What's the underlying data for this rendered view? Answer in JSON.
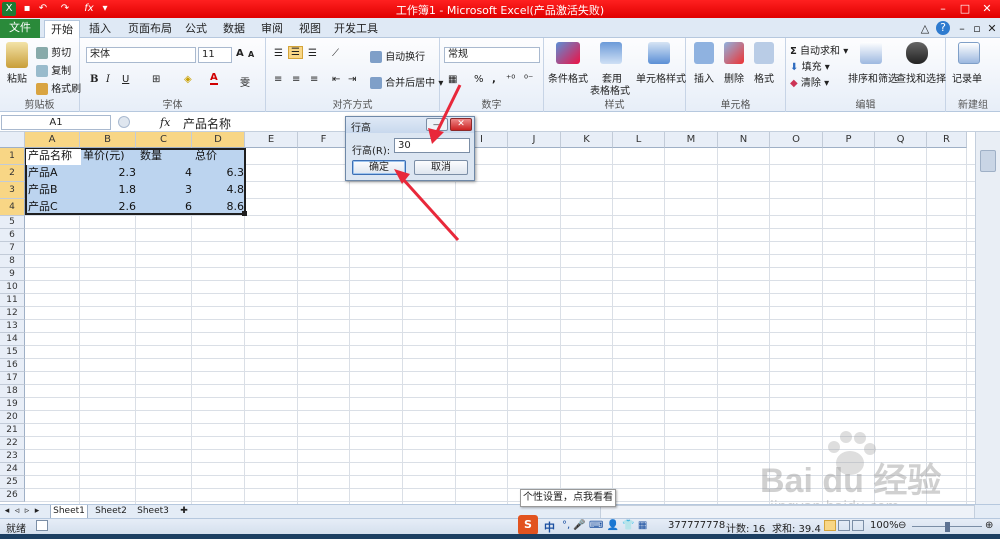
{
  "window": {
    "title": "工作簿1 - Microsoft Excel(产品激活失败)",
    "quick_access": [
      "save-icon",
      "undo-icon",
      "redo-icon",
      "fx-icon",
      "dropdown-icon"
    ]
  },
  "tabs": [
    {
      "label": "文件"
    },
    {
      "label": "开始"
    },
    {
      "label": "插入"
    },
    {
      "label": "页面布局"
    },
    {
      "label": "公式"
    },
    {
      "label": "数据"
    },
    {
      "label": "审阅"
    },
    {
      "label": "视图"
    },
    {
      "label": "开发工具"
    }
  ],
  "ribbon": {
    "clipboard": {
      "label": "剪贴板",
      "paste": "粘贴",
      "cut": "剪切",
      "copy": "复制",
      "format_painter": "格式刷"
    },
    "font": {
      "label": "字体",
      "name": "宋体",
      "size": "11"
    },
    "alignment": {
      "label": "对齐方式",
      "wrap": "自动换行",
      "merge": "合并后居中"
    },
    "number": {
      "label": "数字",
      "format": "常规",
      "percent": "%",
      "comma": ","
    },
    "styles": {
      "label": "样式",
      "conditional": "条件格式",
      "table1": "套用",
      "table2": "表格格式",
      "cell_styles": "单元格样式"
    },
    "cells": {
      "label": "单元格",
      "insert": "插入",
      "delete": "删除",
      "format": "格式"
    },
    "editing": {
      "label": "编辑",
      "autosum": "自动求和",
      "fill": "填充",
      "clear": "清除",
      "sort": "排序和筛选",
      "find": "查找和选择"
    },
    "new_group": {
      "label": "新建组",
      "new_sheet": "记录单"
    }
  },
  "formula_bar": {
    "name_box": "A1",
    "fx": "fx",
    "content": "产品名称"
  },
  "columns": [
    "A",
    "B",
    "C",
    "D",
    "E",
    "F",
    "G",
    "H",
    "I",
    "J",
    "K",
    "L",
    "M",
    "N",
    "O",
    "P",
    "Q",
    "R"
  ],
  "rows": [
    "1",
    "2",
    "3",
    "4",
    "5",
    "6",
    "7",
    "8",
    "9",
    "10",
    "11",
    "12",
    "13",
    "14",
    "15",
    "16",
    "17",
    "18",
    "19",
    "20",
    "21",
    "22",
    "23",
    "24",
    "25",
    "26",
    "27"
  ],
  "table": {
    "header": [
      "产品名称",
      "单价(元)",
      "数量",
      "总价"
    ],
    "rows": [
      [
        "产品A",
        "2.3",
        "4",
        "6.3"
      ],
      [
        "产品B",
        "1.8",
        "3",
        "4.8"
      ],
      [
        "产品C",
        "2.6",
        "6",
        "8.6"
      ]
    ]
  },
  "dialog": {
    "title": "行高",
    "label": "行高(R):",
    "value": "30",
    "ok": "确定",
    "cancel": "取消"
  },
  "sheets": [
    "Sheet1",
    "Sheet2",
    "Sheet3"
  ],
  "status": {
    "ready": "就绪",
    "num": "377777778",
    "count": "计数: 16",
    "sum": "求和: 39.4",
    "zoom": "100%"
  },
  "tooltip": "个性设置，点我看看",
  "ime": [
    "中"
  ],
  "watermark": {
    "brand": "Bai du 经验",
    "url": "jingyan.baidu.com"
  },
  "colors": {
    "title_red": "#e00000",
    "selection": "#bcd4ef",
    "accent": "#f8d685"
  }
}
